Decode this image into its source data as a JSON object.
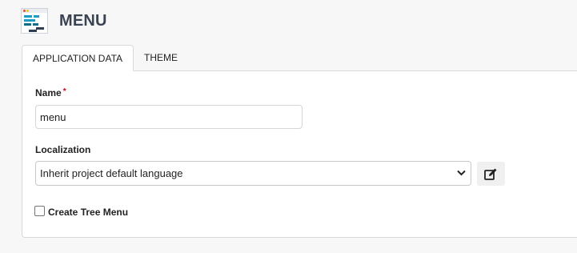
{
  "header": {
    "title": "MENU",
    "icon": "menu-app-icon"
  },
  "tabs": [
    {
      "label": "APPLICATION DATA",
      "active": true
    },
    {
      "label": "THEME",
      "active": false
    }
  ],
  "form": {
    "name": {
      "label": "Name",
      "required_mark": "*",
      "value": "menu"
    },
    "localization": {
      "label": "Localization",
      "selected": "Inherit project default language",
      "edit_icon": "edit-icon"
    },
    "tree_menu": {
      "label": "Create Tree Menu",
      "checked": false
    }
  },
  "colors": {
    "required": "#d0021b",
    "title": "#3b4452"
  }
}
